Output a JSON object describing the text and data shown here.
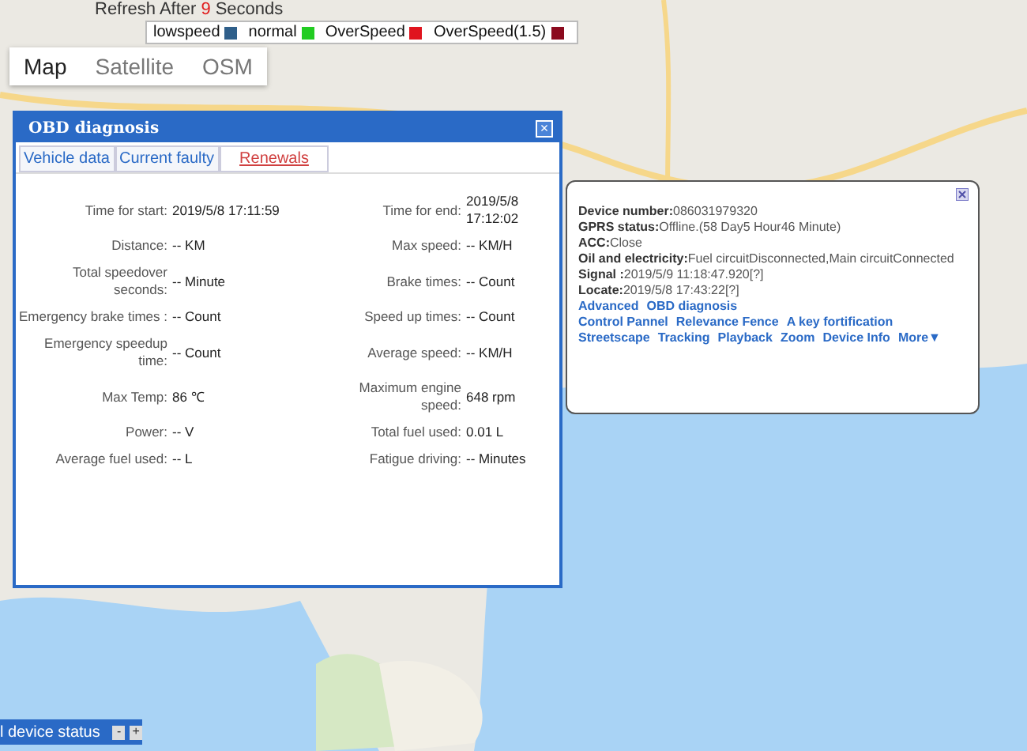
{
  "refresh": {
    "label": "Refresh After",
    "seconds": "9",
    "unit": "Seconds"
  },
  "map_types": [
    {
      "label": "Map",
      "selected": true
    },
    {
      "label": "Satellite",
      "selected": false
    },
    {
      "label": "OSM",
      "selected": false
    }
  ],
  "legend": [
    {
      "label": "lowspeed",
      "color": "#2f5f8a"
    },
    {
      "label": "normal",
      "color": "#22cc22"
    },
    {
      "label": "OverSpeed",
      "color": "#e0141e"
    },
    {
      "label": "OverSpeed(1.5)",
      "color": "#8b0a1e"
    }
  ],
  "obd_dialog": {
    "title": "OBD diagnosis",
    "close": "×",
    "tabs": [
      {
        "label": "Vehicle data",
        "selected": false
      },
      {
        "label": "Current faulty",
        "selected": false
      },
      {
        "label": "Renewals",
        "selected": true
      }
    ],
    "rows": [
      [
        {
          "label": "Time for start:",
          "value": "2019/5/8 17:11:59"
        },
        {
          "label": "Time for end:",
          "value": "2019/5/8 17:12:02"
        }
      ],
      [
        {
          "label": "Distance:",
          "value": "-- KM"
        },
        {
          "label": "Max speed:",
          "value": "-- KM/H"
        }
      ],
      [
        {
          "label": "Total speedover seconds:",
          "value": "-- Minute"
        },
        {
          "label": "Brake times:",
          "value": "-- Count"
        }
      ],
      [
        {
          "label": "Emergency brake times :",
          "value": "-- Count"
        },
        {
          "label": "Speed up times:",
          "value": "-- Count"
        }
      ],
      [
        {
          "label": "Emergency speedup time:",
          "value": "-- Count"
        },
        {
          "label": "Average speed:",
          "value": "-- KM/H"
        }
      ],
      [
        {
          "label": "Max Temp:",
          "value": "86 ℃"
        },
        {
          "label": "Maximum engine speed:",
          "value": "648 rpm"
        }
      ],
      [
        {
          "label": "Power:",
          "value": "-- V"
        },
        {
          "label": "Total fuel used:",
          "value": "0.01 L"
        }
      ],
      [
        {
          "label": "Average fuel used:",
          "value": "-- L"
        },
        {
          "label": "Fatigue driving:",
          "value": "-- Minutes"
        }
      ]
    ]
  },
  "info_popup": {
    "lines": [
      {
        "label": "Device number:",
        "value": "086031979320"
      },
      {
        "label": "GPRS status:",
        "value": "Offline.(58 Day5 Hour46 Minute)"
      },
      {
        "label": "ACC:",
        "value": "Close"
      },
      {
        "label": "Oil and electricity:",
        "value": "Fuel circuitDisconnected,Main circuitConnected"
      },
      {
        "label": "Signal :",
        "value": "2019/5/9 11:18:47.920[?]"
      },
      {
        "label": "Locate:",
        "value": "2019/5/8 17:43:22[?]"
      }
    ],
    "link_rows": [
      [
        "Advanced",
        "OBD diagnosis"
      ],
      [
        "Control Pannel",
        "Relevance Fence",
        "A key fortification"
      ],
      [
        "Streetscape",
        "Tracking",
        "Playback",
        "Zoom",
        "Device Info",
        "More▼"
      ]
    ]
  },
  "device_status": {
    "label": "l device status",
    "buttons": [
      "-",
      "+"
    ]
  }
}
